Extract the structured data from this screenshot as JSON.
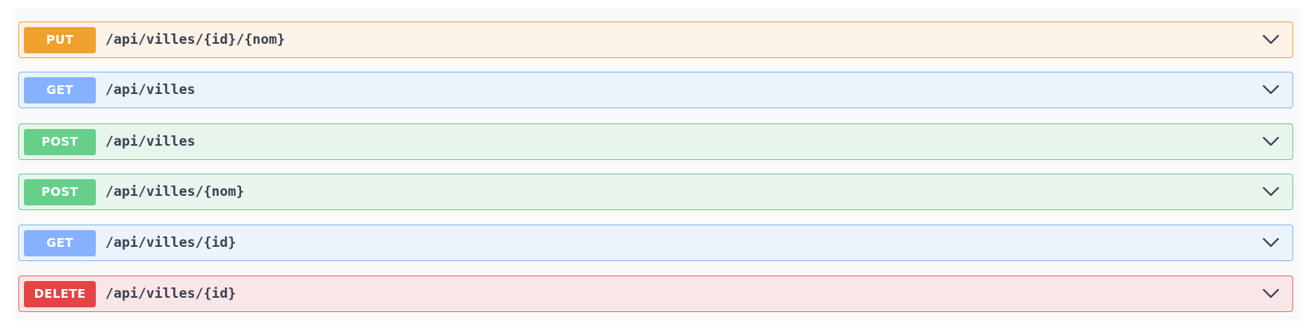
{
  "operations": [
    {
      "method": "PUT",
      "path": "/api/villes/{id}/{nom}",
      "kind": "put"
    },
    {
      "method": "GET",
      "path": "/api/villes",
      "kind": "get"
    },
    {
      "method": "POST",
      "path": "/api/villes",
      "kind": "post"
    },
    {
      "method": "POST",
      "path": "/api/villes/{nom}",
      "kind": "post"
    },
    {
      "method": "GET",
      "path": "/api/villes/{id}",
      "kind": "get"
    },
    {
      "method": "DELETE",
      "path": "/api/villes/{id}",
      "kind": "delete"
    }
  ],
  "icons": {
    "expand": "chevron-down-icon"
  },
  "colors": {
    "put": "#f0a12b",
    "get": "#86b1ff",
    "post": "#66cf8a",
    "delete": "#e34444",
    "path_text": "#3b4151"
  }
}
